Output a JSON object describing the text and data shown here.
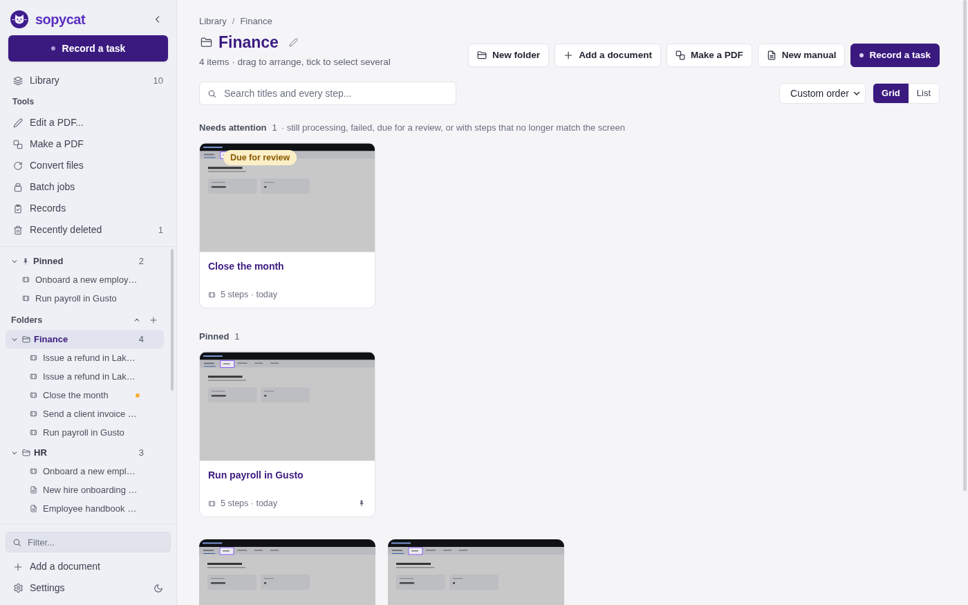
{
  "sidebar": {
    "brand": "sopycat",
    "record_button": {
      "label": "Record a task"
    },
    "library": {
      "label": "Library",
      "count": "10",
      "selected": false
    },
    "tools": {
      "heading": "Tools",
      "items": [
        {
          "label": "Edit a PDF...",
          "selected": false
        },
        {
          "label": "Make a PDF",
          "selected": false
        },
        {
          "label": "Convert files",
          "selected": false
        },
        {
          "label": "Batch jobs",
          "selected": false
        },
        {
          "label": "Records",
          "selected": false
        },
        {
          "label": "Recently deleted",
          "count": "1",
          "selected": false
        }
      ]
    },
    "pinned": {
      "label": "Pinned",
      "count": "2",
      "expanded": true,
      "items": [
        {
          "label": "Onboard a new employ…",
          "kind": "recording",
          "selected": false
        },
        {
          "label": "Run payroll in Gusto",
          "kind": "recording",
          "selected": false
        }
      ]
    },
    "folders": {
      "heading": "Folders",
      "expanded": true,
      "tree": [
        {
          "label": "Finance",
          "count": "4",
          "selected": true,
          "expanded": true,
          "children": [
            {
              "label": "Issue a refund in Lak…",
              "kind": "recording",
              "selected": false,
              "needs_attention": false
            },
            {
              "label": "Issue a refund in Lak…",
              "kind": "recording",
              "selected": false,
              "needs_attention": false
            },
            {
              "label": "Close the month",
              "kind": "recording",
              "selected": false,
              "needs_attention": true
            },
            {
              "label": "Send a client invoice …",
              "kind": "recording",
              "selected": false,
              "needs_attention": false
            },
            {
              "label": "Run payroll in Gusto",
              "kind": "recording",
              "selected": false,
              "needs_attention": false
            }
          ]
        },
        {
          "label": "HR",
          "count": "3",
          "selected": false,
          "expanded": true,
          "children": [
            {
              "label": "Onboard a new empl…",
              "kind": "recording",
              "selected": false,
              "needs_attention": false
            },
            {
              "label": "New hire onboarding …",
              "kind": "document",
              "selected": false,
              "needs_attention": false
            },
            {
              "label": "Employee handbook …",
              "kind": "document",
              "selected": false,
              "needs_attention": false
            }
          ]
        }
      ]
    },
    "filter": {
      "placeholder": "Filter..."
    },
    "add_document": {
      "label": "Add a document"
    },
    "settings": {
      "label": "Settings"
    }
  },
  "main": {
    "breadcrumb": {
      "items": [
        "Library",
        "Finance"
      ],
      "separator": "/"
    },
    "title": "Finance",
    "subtitle": "4 items · drag to arrange, tick to select several",
    "actions": [
      {
        "label": "New folder",
        "kind": "secondary"
      },
      {
        "label": "Add a document",
        "kind": "secondary"
      },
      {
        "label": "Make a PDF",
        "kind": "secondary"
      },
      {
        "label": "New manual",
        "kind": "secondary"
      },
      {
        "label": "Record a task",
        "kind": "primary"
      }
    ],
    "search": {
      "placeholder": "Search titles and every step..."
    },
    "sort": {
      "value": "Custom order"
    },
    "view_options": [
      {
        "label": "Grid",
        "selected": true
      },
      {
        "label": "List",
        "selected": false
      }
    ],
    "sections": [
      {
        "title": "Needs attention",
        "count": "1",
        "note": "· still processing, failed, due for a review, or with steps that no longer match the screen",
        "cards": [
          {
            "kind": "recording",
            "title": "Close the month",
            "meta": "5 steps · today",
            "badge": "Due for review",
            "pinned": false
          }
        ]
      },
      {
        "title": "Pinned",
        "count": "1",
        "cards": [
          {
            "kind": "recording",
            "title": "Run payroll in Gusto",
            "meta": "5 steps · today",
            "pinned": true
          }
        ]
      },
      {
        "cards": [
          {
            "kind": "recording"
          },
          {
            "kind": "recording"
          }
        ]
      }
    ]
  }
}
